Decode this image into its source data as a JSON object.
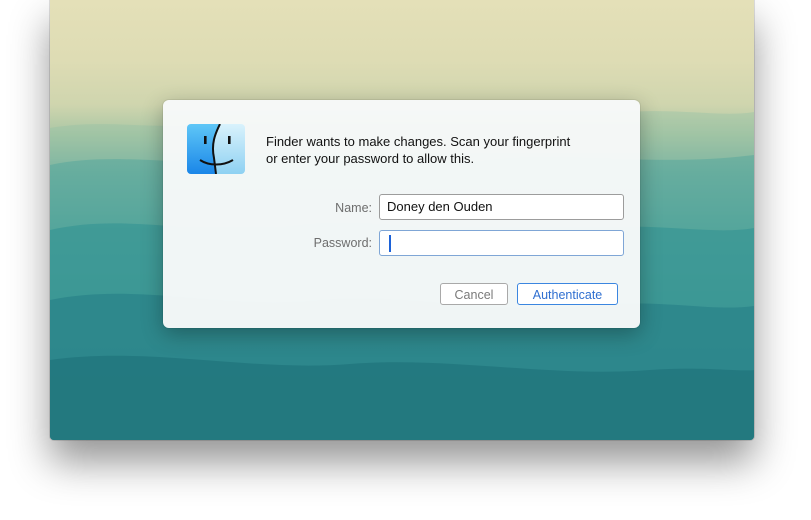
{
  "dialog": {
    "message_line1": "Finder wants to make changes. Scan your fingerprint",
    "message_line2": "or enter your password to allow this.",
    "app_icon": "finder-icon",
    "name_label": "Name:",
    "name_value": "Doney den Ouden",
    "password_label": "Password:",
    "password_value": "",
    "cancel_label": "Cancel",
    "authenticate_label": "Authenticate"
  },
  "colors": {
    "accent": "#2f6fd0",
    "finder_blue": "#1e8ff0",
    "background_top": "#e4e0b8",
    "background_bottom": "#1f747d"
  }
}
